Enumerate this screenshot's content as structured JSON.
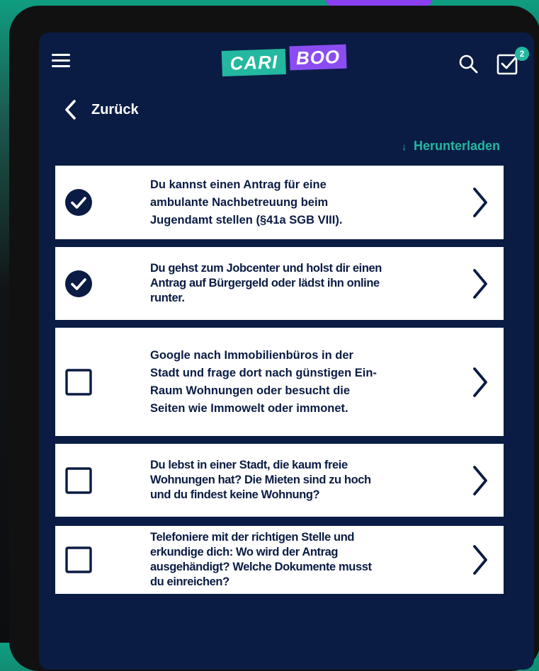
{
  "header": {
    "logo_part1": "CARI",
    "logo_part2": "BOO",
    "notification_count": "2"
  },
  "nav": {
    "back_label": "Zurück",
    "download_label": "Herunterladen",
    "download_icon": "↓"
  },
  "colors": {
    "background": "#0a1c44",
    "accent_teal": "#23b89f",
    "accent_purple": "#8b4df2",
    "card": "#ffffff",
    "text_dark": "#0a1c44"
  },
  "items": [
    {
      "checked": true,
      "text": "Du kannst einen Antrag für eine ambulante Nachbetreuung beim Jugendamt stellen (§41a SGB VIII)."
    },
    {
      "checked": true,
      "text": "Du gehst zum Jobcenter und holst dir einen Antrag auf Bürgergeld oder lädst ihn online runter."
    },
    {
      "checked": false,
      "text": "Google nach Immobilienbüros in der Stadt und frage dort nach günstigen Ein-Raum Wohnungen oder besucht die Seiten wie Immowelt oder immonet."
    },
    {
      "checked": false,
      "text": "Du lebst in einer Stadt, die kaum freie Wohnungen hat? Die Mieten sind zu hoch und du findest keine Wohnung?"
    },
    {
      "checked": false,
      "text": "Telefoniere mit der richtigen Stelle und erkundige dich: Wo wird der Antrag ausgehändigt? Welche Dokumente musst du einreichen?"
    }
  ]
}
